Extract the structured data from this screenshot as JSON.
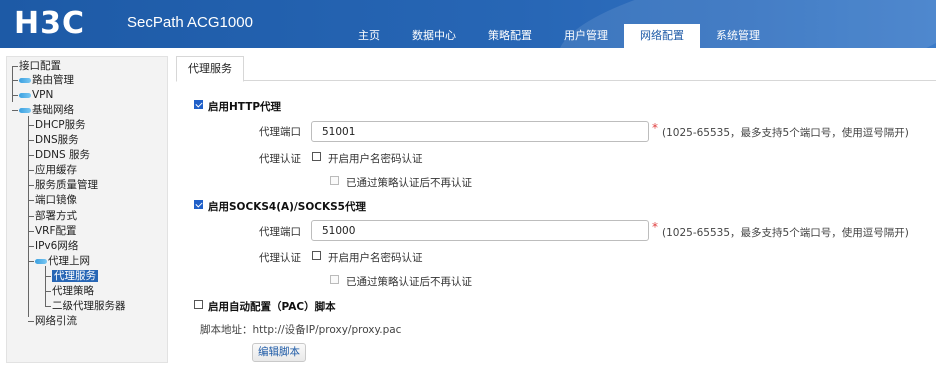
{
  "header": {
    "logo_text": "H3C",
    "product_name": "SecPath ACG1000",
    "nav": [
      "主页",
      "数据中心",
      "策略配置",
      "用户管理",
      "网络配置",
      "系统管理"
    ],
    "active_nav": "网络配置"
  },
  "sidebar": {
    "items": [
      "接口配置",
      "路由管理",
      "VPN",
      "基础网络",
      "DHCP服务",
      "DNS服务",
      "DDNS 服务",
      "应用缓存",
      "服务质量管理",
      "端口镜像",
      "部署方式",
      "VRF配置",
      "IPv6网络",
      "代理上网",
      "代理服务",
      "代理策略",
      "二级代理服务器",
      "网络引流"
    ],
    "selected": "代理服务"
  },
  "main": {
    "tab_label": "代理服务",
    "http": {
      "enable_label": "启用HTTP代理",
      "port_label": "代理端口",
      "port_value": "51001",
      "required_mark": "*",
      "port_hint": "(1025-65535，最多支持5个端口号，使用逗号隔开)",
      "auth_label": "代理认证",
      "auth_option": "开启用户名密码认证",
      "skip_option": "已通过策略认证后不再认证"
    },
    "socks": {
      "enable_label": "启用SOCKS4(A)/SOCKS5代理",
      "port_label": "代理端口",
      "port_value": "51000",
      "required_mark": "*",
      "port_hint": "(1025-65535，最多支持5个端口号，使用逗号隔开)",
      "auth_label": "代理认证",
      "auth_option": "开启用户名密码认证",
      "skip_option": "已通过策略认证后不再认证"
    },
    "pac": {
      "enable_label": "启用自动配置（PAC）脚本",
      "script_address": "脚本地址：http://设备IP/proxy/proxy.pac",
      "edit_button": "编辑脚本"
    }
  },
  "icons": {
    "tree_leaf": "leaf-icon",
    "checkbox_checked_color": "#1f5fc8"
  }
}
